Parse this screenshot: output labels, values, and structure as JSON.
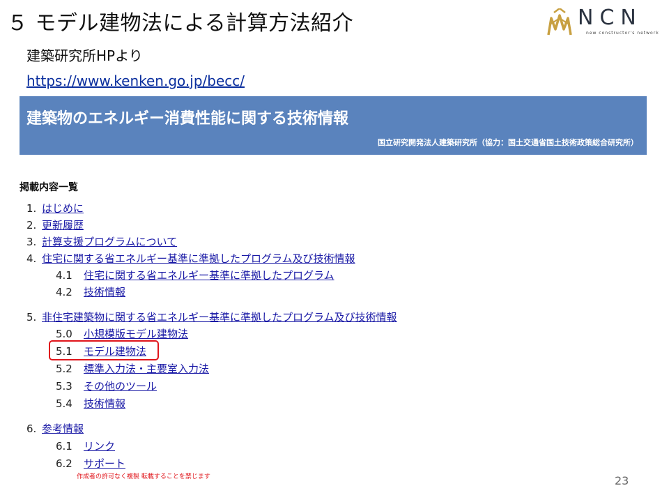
{
  "slide": {
    "title": "５ モデル建物法による計算方法紹介",
    "page_number": "23",
    "copyright": "作成者の許可なく複製 転載することを禁じます"
  },
  "logo": {
    "text": "NCN",
    "subtitle": "new constructor's network",
    "icon": "ncn-logo-icon"
  },
  "source": {
    "label": "建築研究所HPより",
    "url": "https://www.kenken.go.jp/becc/"
  },
  "banner": {
    "title": "建築物のエネルギー消費性能に関する技術情報",
    "subtitle": "国立研究開発法人建築研究所（協力：国土交通省国土技術政策総合研究所）"
  },
  "contents": {
    "heading": "掲載内容一覧",
    "items": [
      {
        "num": "1.",
        "label": "はじめに"
      },
      {
        "num": "2.",
        "label": "更新履歴"
      },
      {
        "num": "3.",
        "label": "計算支援プログラムについて"
      },
      {
        "num": "4.",
        "label": "住宅に関する省エネルギー基準に準拠したプログラム及び技術情報",
        "children": [
          {
            "num": "4.1",
            "label": "住宅に関する省エネルギー基準に準拠したプログラム"
          },
          {
            "num": "4.2",
            "label": "技術情報"
          }
        ]
      },
      {
        "num": "5.",
        "label": "非住宅建築物に関する省エネルギー基準に準拠したプログラム及び技術情報",
        "children": [
          {
            "num": "5.0",
            "label": "小規模版モデル建物法"
          },
          {
            "num": "5.1",
            "label": "モデル建物法"
          },
          {
            "num": "5.2",
            "label": "標準入力法・主要室入力法"
          },
          {
            "num": "5.3",
            "label": "その他のツール"
          },
          {
            "num": "5.4",
            "label": "技術情報"
          }
        ]
      },
      {
        "num": "6.",
        "label": "参考情報",
        "children": [
          {
            "num": "6.1",
            "label": "リンク"
          },
          {
            "num": "6.2",
            "label": "サポート"
          }
        ]
      }
    ]
  },
  "colors": {
    "banner": "#5a83bd",
    "link": "#1a1aa6",
    "highlight": "#e0151b",
    "logo_gold": "#c8a041"
  }
}
